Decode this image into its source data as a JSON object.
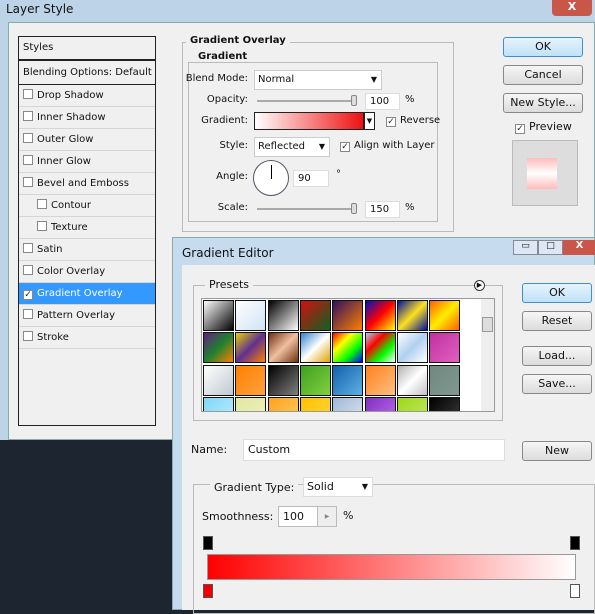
{
  "layer_style": {
    "title": "Layer Style",
    "close": "X",
    "styles_header": "Styles",
    "blending": "Blending Options: Default",
    "items": [
      {
        "label": "Drop Shadow",
        "checked": false,
        "indent": false
      },
      {
        "label": "Inner Shadow",
        "checked": false,
        "indent": false
      },
      {
        "label": "Outer Glow",
        "checked": false,
        "indent": false
      },
      {
        "label": "Inner Glow",
        "checked": false,
        "indent": false
      },
      {
        "label": "Bevel and Emboss",
        "checked": false,
        "indent": false
      },
      {
        "label": "Contour",
        "checked": false,
        "indent": true
      },
      {
        "label": "Texture",
        "checked": false,
        "indent": true
      },
      {
        "label": "Satin",
        "checked": false,
        "indent": false
      },
      {
        "label": "Color Overlay",
        "checked": false,
        "indent": false
      },
      {
        "label": "Gradient Overlay",
        "checked": true,
        "indent": false,
        "selected": true
      },
      {
        "label": "Pattern Overlay",
        "checked": false,
        "indent": false
      },
      {
        "label": "Stroke",
        "checked": false,
        "indent": false
      }
    ],
    "section": "Gradient Overlay",
    "subsection": "Gradient",
    "blend_mode_label": "Blend Mode:",
    "blend_mode": "Normal",
    "opacity_label": "Opacity:",
    "opacity": "100",
    "opacity_unit": "%",
    "gradient_label": "Gradient:",
    "reverse": "Reverse",
    "style_label": "Style:",
    "style": "Reflected",
    "align": "Align with Layer",
    "angle_label": "Angle:",
    "angle": "90",
    "angle_unit": "°",
    "scale_label": "Scale:",
    "scale": "150",
    "scale_unit": "%",
    "ok": "OK",
    "cancel": "Cancel",
    "new_style": "New Style...",
    "preview": "Preview"
  },
  "gradient_editor": {
    "title": "Gradient Editor",
    "presets": "Presets",
    "ok": "OK",
    "reset": "Reset",
    "load": "Load...",
    "save": "Save...",
    "name_label": "Name:",
    "name": "Custom",
    "new": "New",
    "type_label": "Gradient Type:",
    "type": "Solid",
    "smoothness_label": "Smoothness:",
    "smoothness": "100",
    "smoothness_unit": "%",
    "gradient_colors": [
      "#ff0000",
      "#ffffff"
    ],
    "swatches": [
      [
        "#ffffff",
        "#000000"
      ],
      [
        "#ffffff",
        "#cfe3f5"
      ],
      [
        "#000000",
        "#ffffff"
      ],
      [
        "#d01010",
        "#106020"
      ],
      [
        "#301060",
        "#ff8000"
      ],
      [
        "#0010c0",
        "#ff0000",
        "#ffff00"
      ],
      [
        "#0010a0",
        "#ffe020",
        "#0010a0"
      ],
      [
        "#ff6000",
        "#ffee00",
        "#ff6000"
      ],
      [
        "#602080",
        "#208030",
        "#ff8000"
      ],
      [
        "#e8d000",
        "#603090",
        "#ff8000"
      ],
      [
        "#703010",
        "#f0c0a0",
        "#703010"
      ],
      [
        "#3080d0",
        "#ffffff",
        "#e0a000"
      ],
      [
        "#ff0000",
        "#ffff00",
        "#00ff00",
        "#0000ff"
      ],
      [
        "#b0d0f0",
        "#ff0000",
        "#00ff00",
        "#ffffff"
      ],
      [
        "#ffffff",
        "#b0d0f0",
        "#ffffff"
      ],
      [
        "#c030a0",
        "#e060c0"
      ],
      [
        "#ffffff",
        "#c0c8d0"
      ],
      [
        "#ff8000",
        "#ffa040"
      ],
      [
        "#000000",
        "#808080"
      ],
      [
        "#40a020",
        "#80d040"
      ],
      [
        "#1060b0",
        "#60b0e0"
      ],
      [
        "#ff8020",
        "#ffc080"
      ],
      [
        "#b0b0b0",
        "#ffffff",
        "#c0c0c0"
      ],
      [
        "#708880",
        "#809890"
      ],
      [
        "#80d8f8",
        "#c0ecff"
      ],
      [
        "#e0e8a0",
        "#f0f0c0"
      ],
      [
        "#ffa020",
        "#ffd060"
      ],
      [
        "#ffc000",
        "#ffd840"
      ],
      [
        "#a0b8d8",
        "#e0e8f0"
      ],
      [
        "#8030c0",
        "#c070f0"
      ],
      [
        "#a0d820",
        "#c0e860"
      ],
      [
        "#000000",
        "#404040"
      ]
    ]
  }
}
